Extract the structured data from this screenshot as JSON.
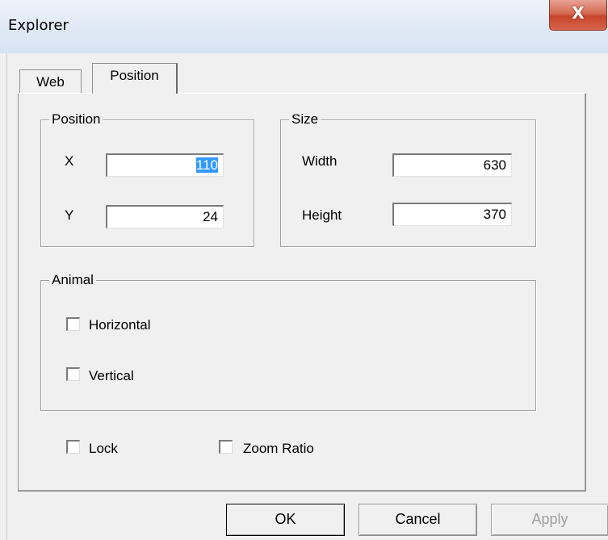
{
  "window": {
    "title": "Explorer",
    "close_symbol": "X"
  },
  "tabs": [
    {
      "label": "Web",
      "active": false
    },
    {
      "label": "Position",
      "active": true
    }
  ],
  "position_group": {
    "label": "Position",
    "x_label": "X",
    "x_value": "110",
    "y_label": "Y",
    "y_value": "24"
  },
  "size_group": {
    "label": "Size",
    "width_label": "Width",
    "width_value": "630",
    "height_label": "Height",
    "height_value": "370"
  },
  "animal_group": {
    "label": "Animal",
    "horizontal_label": "Horizontal",
    "horizontal_checked": false,
    "vertical_label": "Vertical",
    "vertical_checked": false
  },
  "options": {
    "lock_label": "Lock",
    "lock_checked": false,
    "zoom_ratio_label": "Zoom Ratio",
    "zoom_ratio_checked": false
  },
  "buttons": {
    "ok": "OK",
    "cancel": "Cancel",
    "apply": "Apply"
  }
}
